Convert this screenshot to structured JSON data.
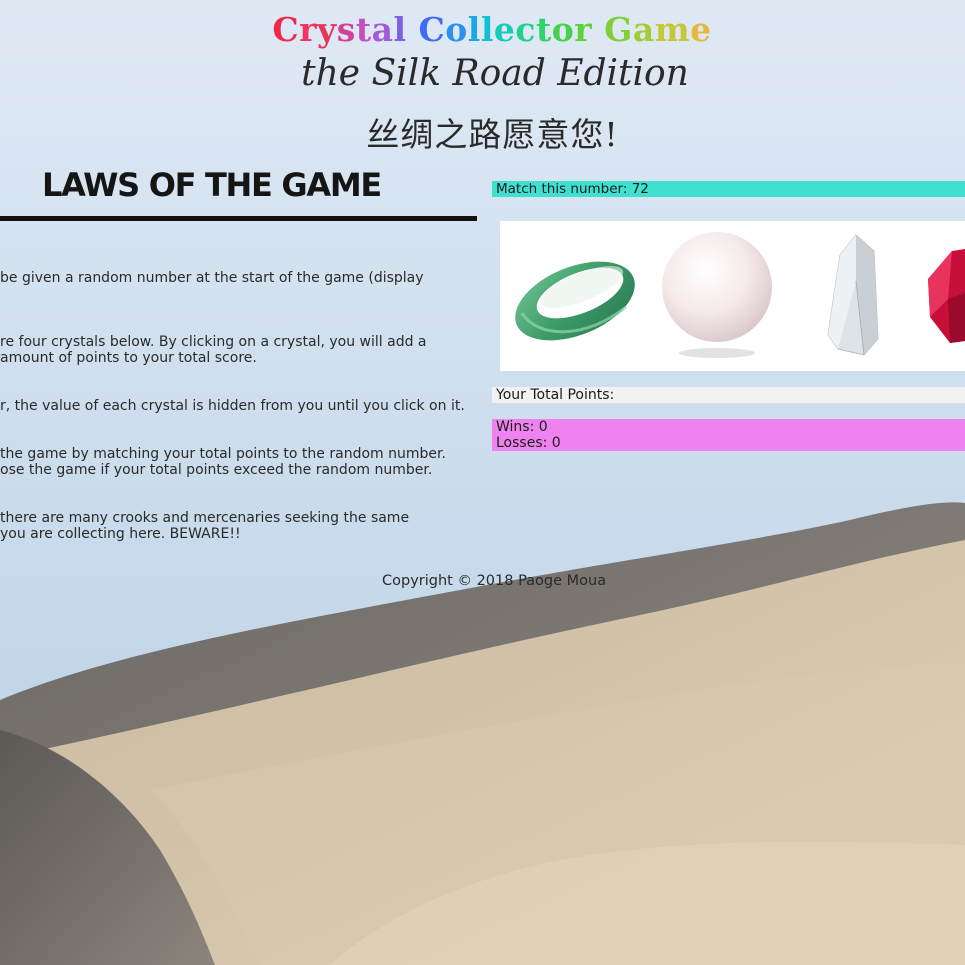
{
  "header": {
    "title_words": [
      {
        "letters": [
          {
            "ch": "C",
            "color": "#f0284a"
          },
          {
            "ch": "r",
            "color": "#f33366"
          },
          {
            "ch": "y",
            "color": "#e5365a"
          },
          {
            "ch": "s",
            "color": "#d2409a"
          },
          {
            "ch": "t",
            "color": "#c44fbf"
          },
          {
            "ch": "a",
            "color": "#a35cd6"
          },
          {
            "ch": "l",
            "color": "#7c61e6"
          }
        ]
      },
      {
        "letters": [
          {
            "ch": "C",
            "color": "#3f6cf2"
          },
          {
            "ch": "o",
            "color": "#2d8fef"
          },
          {
            "ch": "l",
            "color": "#1aa8e5"
          },
          {
            "ch": "l",
            "color": "#13bfd6"
          },
          {
            "ch": "e",
            "color": "#17cbb9"
          },
          {
            "ch": "c",
            "color": "#21d18f"
          },
          {
            "ch": "t",
            "color": "#2ed46a"
          },
          {
            "ch": "o",
            "color": "#43d24a"
          },
          {
            "ch": "r",
            "color": "#5fd03a"
          }
        ]
      },
      {
        "letters": [
          {
            "ch": "G",
            "color": "#7fcf35"
          },
          {
            "ch": "a",
            "color": "#a4cc33"
          },
          {
            "ch": "m",
            "color": "#c7c634"
          },
          {
            "ch": "e",
            "color": "#e6b93c"
          }
        ]
      }
    ],
    "subtitle": "the Silk Road Edition",
    "chinese": "丝绸之路愿意您!"
  },
  "laws": {
    "title": "LAWS OF THE GAME",
    "rules": [
      [
        "be given a random number at the start of the game (display"
      ],
      [
        "re four crystals below. By clicking on a crystal, you will add a",
        " amount of points to your total score."
      ],
      [
        "r, the value of each crystal is hidden from you until you click on it."
      ],
      [
        " the game by matching your total points to the random number.",
        "ose the game if your total points exceed the random number."
      ],
      [
        " there are many crooks and mercenaries seeking the same",
        " you are collecting here. BEWARE!!"
      ]
    ]
  },
  "game": {
    "match_label": "Match this number: 72",
    "crystals": [
      {
        "name": "jade-ring",
        "color": "#3f9a6a"
      },
      {
        "name": "pearl",
        "color": "#f3e6e6"
      },
      {
        "name": "quartz",
        "color": "#d8dde0"
      },
      {
        "name": "ruby",
        "color": "#d0103e"
      }
    ],
    "points_label": "Your Total Points:",
    "wins_label": "Wins: 0",
    "losses_label": "Losses: 0"
  },
  "footer": {
    "copyright": "Copyright © 2018 Paoge Moua"
  }
}
